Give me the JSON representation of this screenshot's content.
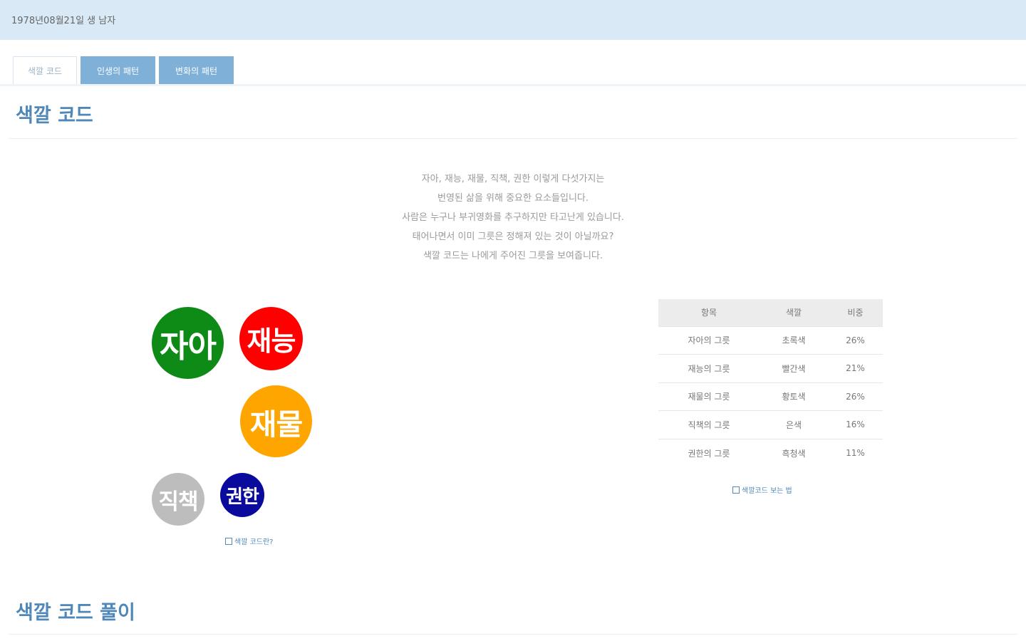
{
  "header": {
    "birth_info": "1978년08월21일 생 남자"
  },
  "tabs": [
    {
      "label": "색깔 코드",
      "active": true
    },
    {
      "label": "인생의 패턴",
      "active": false
    },
    {
      "label": "변화의 패턴",
      "active": false
    }
  ],
  "section1": {
    "title": "색깔 코드"
  },
  "intro": {
    "lines": [
      "자아, 재능, 재물, 직책, 권한 이렇게 다섯가지는",
      "번영된 삶을 위해 중요한 요소들입니다.",
      "사람은 누구나 부귀영화를 추구하지만 타고난게 있습니다.",
      "태어나면서 이미 그릇은 정해져 있는 것이 아닐까요?",
      "색깔 코드는 나에게 주어진 그릇을 보여줍니다."
    ]
  },
  "circles": {
    "ego": {
      "label": "자아",
      "color": "#0e8b17"
    },
    "talent": {
      "label": "재능",
      "color": "#ff0000"
    },
    "wealth": {
      "label": "재물",
      "color": "#ffa500"
    },
    "duty": {
      "label": "직책",
      "color": "#bdbdbd"
    },
    "power": {
      "label": "권한",
      "color": "#0a0a9c"
    }
  },
  "links": {
    "color_code_what": "색깔 코드란?",
    "color_code_view": "색깔코드 보는 법"
  },
  "table": {
    "headers": [
      "항목",
      "색깔",
      "비중"
    ],
    "rows": [
      [
        "자아의 그릇",
        "초록색",
        "26%"
      ],
      [
        "재능의 그릇",
        "빨간색",
        "21%"
      ],
      [
        "재물의 그릇",
        "황토색",
        "26%"
      ],
      [
        "직책의 그릇",
        "은색",
        "16%"
      ],
      [
        "권한의 그릇",
        "흑청색",
        "11%"
      ]
    ]
  },
  "section2": {
    "title": "색깔 코드 풀이"
  }
}
